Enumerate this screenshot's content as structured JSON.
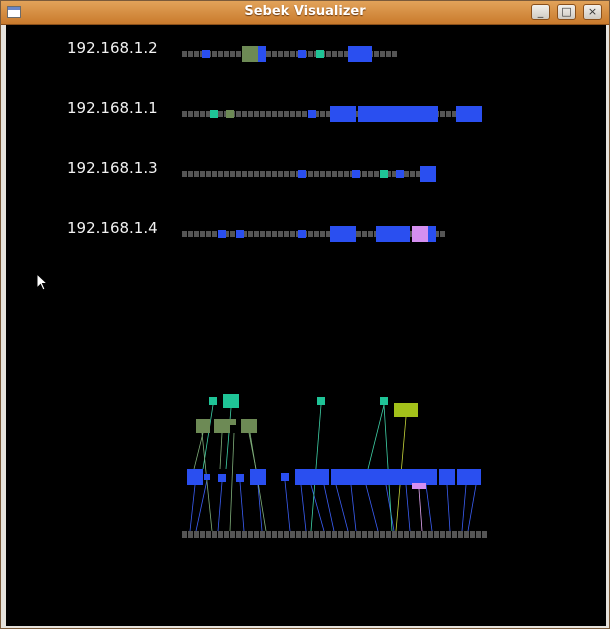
{
  "window": {
    "title": "Sebek Visualizer",
    "buttons": [
      "minimize",
      "maximize",
      "close"
    ]
  },
  "hosts": [
    {
      "ip": "192.168.1.2"
    },
    {
      "ip": "192.168.1.1"
    },
    {
      "ip": "192.168.1.3"
    },
    {
      "ip": "192.168.1.4"
    }
  ],
  "colors": {
    "background": "#000000",
    "idle": "#555555",
    "blue": "#2a4ff0",
    "teal": "#1fc497",
    "olive": "#6d8a55",
    "pink": "#d58ff0",
    "lime": "#a3c11a"
  }
}
